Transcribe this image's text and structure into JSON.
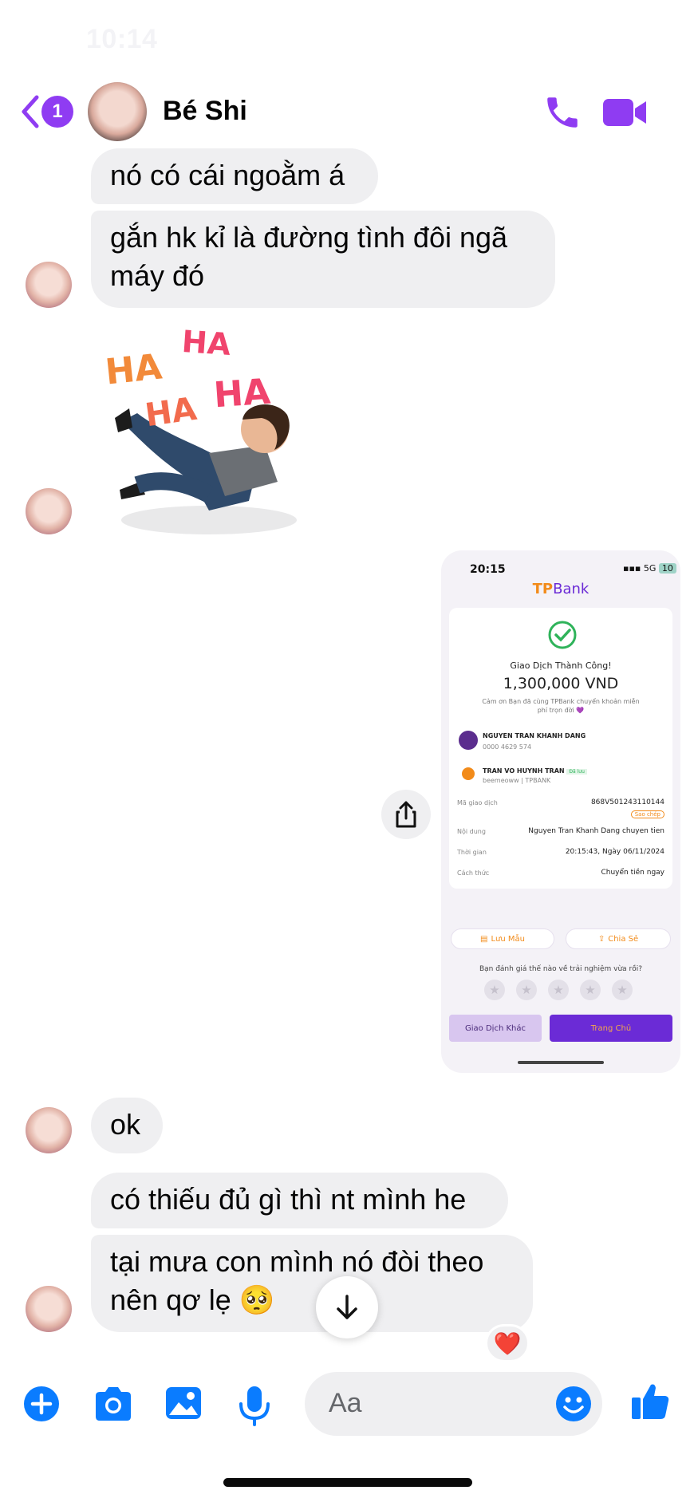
{
  "status_bar": {
    "time": "10:14"
  },
  "header": {
    "unread_count": "1",
    "contact_name": "Bé Shi"
  },
  "messages": {
    "m1": "nó có cái ngoằm á",
    "m2_line1": "gắn hk kỉ là đường tình đôi ngã",
    "m2_line2": "máy đó",
    "sticker_text": [
      "HA",
      "HA",
      "HA",
      "HA"
    ],
    "m3": "ok",
    "m4": "có thiếu đủ gì thì nt mình he",
    "m5_line1": "tại mưa con mình nó đòi theo",
    "m5_line2": "nên qơ lẹ 🥺",
    "reaction": "❤️"
  },
  "receipt": {
    "time": "20:15",
    "signal": "5G",
    "battery": "10",
    "logo_prefix": "TP",
    "logo_suffix": "Bank",
    "status": "Giao Dịch Thành Công!",
    "amount": "1,300,000 VND",
    "thanks": "Cảm ơn Bạn đã cùng TPBank chuyển khoản miễn phí trọn đời 💜",
    "sender_name": "NGUYEN TRAN KHANH DANG",
    "sender_account": "0000 4629 574",
    "receiver_name": "TRAN VO HUYNH TRAN",
    "receiver_tag": "Đã lưu",
    "receiver_account": "beemeoww | TPBANK",
    "txn_label": "Mã giao dịch",
    "txn_value": "868V501243110144",
    "copy_label": "Sao chép",
    "content_label": "Nội dung",
    "content_value": "Nguyen Tran Khanh Dang chuyen tien",
    "time_label": "Thời gian",
    "time_value": "20:15:43, Ngày 06/11/2024",
    "method_label": "Cách thức",
    "method_value": "Chuyển tiền ngay",
    "save_template": "Lưu Mẫu",
    "share": "Chia Sẻ",
    "rating_prompt": "Bạn đánh giá thế nào về trải nghiệm vừa rồi?",
    "other_txn": "Giao Dịch Khác",
    "home": "Trang Chủ"
  },
  "composer": {
    "placeholder": "Aa"
  },
  "colors": {
    "accent": "#8f3cf2",
    "messenger_blue": "#0a7cff",
    "bubble": "#efeff1"
  },
  "icons": [
    "back-icon",
    "phone-icon",
    "video-icon",
    "share-icon",
    "arrow-down-icon",
    "plus-icon",
    "camera-icon",
    "image-icon",
    "mic-icon",
    "emoji-icon",
    "thumbs-up-icon"
  ]
}
